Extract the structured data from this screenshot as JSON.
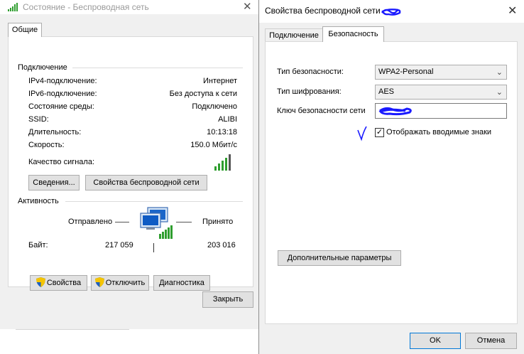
{
  "status_window": {
    "title": "Состояние - Беспроводная сеть",
    "tab": "Общие",
    "connection": {
      "heading": "Подключение",
      "rows": [
        {
          "label": "IPv4-подключение:",
          "value": "Интернет"
        },
        {
          "label": "IPv6-подключение:",
          "value": "Без доступа к сети"
        },
        {
          "label": "Состояние среды:",
          "value": "Подключено"
        },
        {
          "label": "SSID:",
          "value": "ALIBI"
        },
        {
          "label": "Длительность:",
          "value": "10:13:18"
        },
        {
          "label": "Скорость:",
          "value": "150.0 Мбит/с"
        }
      ],
      "signal_label": "Качество сигнала:",
      "signal_bars": 5,
      "details_button": "Сведения...",
      "wireless_props_button": "Свойства беспроводной сети"
    },
    "activity": {
      "heading": "Активность",
      "sent_label": "Отправлено",
      "received_label": "Принято",
      "bytes_label": "Байт:",
      "bytes_sent": "217 059",
      "bytes_received": "203 016"
    },
    "buttons": {
      "properties": "Свойства",
      "disable": "Отключить",
      "diagnostics": "Диагностика",
      "close": "Закрыть"
    },
    "colors": {
      "signal": "#2f9e2f",
      "shield_blue": "#1f5fbf",
      "shield_yellow": "#f5c400"
    }
  },
  "props_window": {
    "title": "Свойства беспроводной сети",
    "tabs": [
      "Подключение",
      "Безопасность"
    ],
    "active_tab": "Безопасность",
    "security_type_label": "Тип безопасности:",
    "security_type_value": "WPA2-Personal",
    "encryption_type_label": "Тип шифрования:",
    "encryption_type_value": "AES",
    "key_label": "Ключ безопасности сети",
    "show_chars_label": "Отображать вводимые знаки",
    "show_chars_checked": true,
    "show_chars_mark": "✓",
    "advanced_button": "Дополнительные параметры",
    "ok_button": "OK",
    "cancel_button": "Отмена",
    "colors": {
      "scribble": "#1a1aff",
      "focus_border": "#0078d7"
    }
  }
}
